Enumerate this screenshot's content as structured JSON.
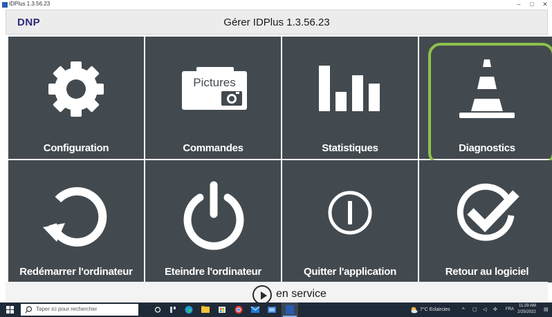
{
  "window": {
    "title": "IDPlus 1.3.56.23",
    "minimize": "–",
    "maximize": "□",
    "close": "✕"
  },
  "header": {
    "brand": "DNP",
    "title": "Gérer IDPlus 1.3.56.23"
  },
  "tiles": [
    {
      "label": "Configuration",
      "icon": "gear-icon"
    },
    {
      "label": "Commandes",
      "icon": "pictures-camera-icon",
      "icon_text": "Pictures"
    },
    {
      "label": "Statistiques",
      "icon": "bar-chart-icon"
    },
    {
      "label": "Diagnostics",
      "icon": "traffic-cone-icon",
      "selected": true
    },
    {
      "label": "Redémarrer l'ordinateur",
      "icon": "restart-icon"
    },
    {
      "label": "Eteindre l'ordinateur",
      "icon": "power-icon"
    },
    {
      "label": "Quitter l'application",
      "icon": "exit-icon"
    },
    {
      "label": "Retour au logiciel",
      "icon": "checkmark-icon"
    }
  ],
  "service": {
    "label": "en service"
  },
  "taskbar": {
    "search_placeholder": "Taper ici pour rechercher",
    "weather": "7°C Eclaircies",
    "lang": "FRA",
    "time": "11:29 AM",
    "date": "2/25/2022"
  },
  "colors": {
    "tile": "#434a4f",
    "highlight": "#8bc34a",
    "brand": "#2c2a7a",
    "taskbar": "#1f2a38"
  }
}
